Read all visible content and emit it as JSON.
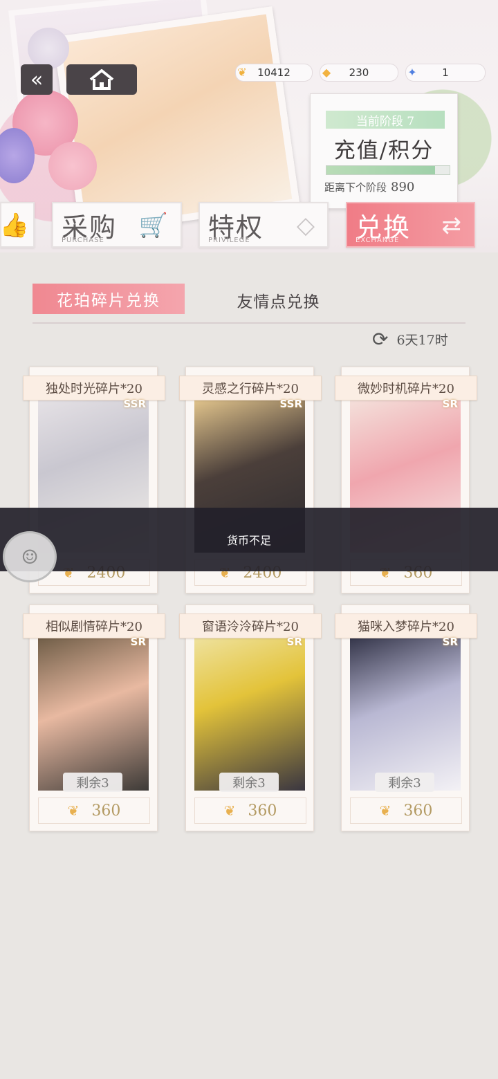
{
  "nav": {
    "back_icon": "«",
    "home_icon": "⌂"
  },
  "currencies": [
    {
      "icon": "gold-leaf-icon",
      "glyph": "❦",
      "value": "10412",
      "color": "#f0b13e"
    },
    {
      "icon": "amber-crystal-icon",
      "glyph": "◆",
      "value": "230",
      "color": "#f2b341"
    },
    {
      "icon": "ticket-icon",
      "glyph": "✦",
      "value": "1",
      "color": "#4f7fe0"
    }
  ],
  "stage": {
    "label": "当前阶段 7",
    "title": "充值/积分",
    "progress": 0.88,
    "next_label": "距离下个阶段",
    "next_value": "890"
  },
  "tabs": [
    {
      "cn": "采购",
      "en": "PURCHASE",
      "icon": "🛒"
    },
    {
      "cn": "特权",
      "en": "PRIVILEGE",
      "icon": "◇"
    },
    {
      "cn": "兑换",
      "en": "EXCHANGE",
      "icon": "⇄"
    }
  ],
  "subtabs": {
    "active": "花珀碎片兑换",
    "inactive": "友情点兑换"
  },
  "refresh": {
    "icon": "⟳",
    "time": "6天17时"
  },
  "cards": [
    {
      "title": "独处时光碎片*20",
      "rarity": "SSR",
      "price": "2400",
      "remain": ""
    },
    {
      "title": "灵感之行碎片*20",
      "rarity": "SSR",
      "price": "2400",
      "remain": ""
    },
    {
      "title": "微妙时机碎片*20",
      "rarity": "SR",
      "price": "360",
      "remain": ""
    },
    {
      "title": "相似剧情碎片*20",
      "rarity": "SR",
      "price": "360",
      "remain": "剩余3"
    },
    {
      "title": "窗语泠泠碎片*20",
      "rarity": "SR",
      "price": "360",
      "remain": "剩余3"
    },
    {
      "title": "猫咪入梦碎片*20",
      "rarity": "SR",
      "price": "360",
      "remain": "剩余3"
    }
  ],
  "toast": {
    "message": "货币不足"
  },
  "colors": {
    "accent": "#f08891",
    "stage_green": "#b7dfbf"
  }
}
